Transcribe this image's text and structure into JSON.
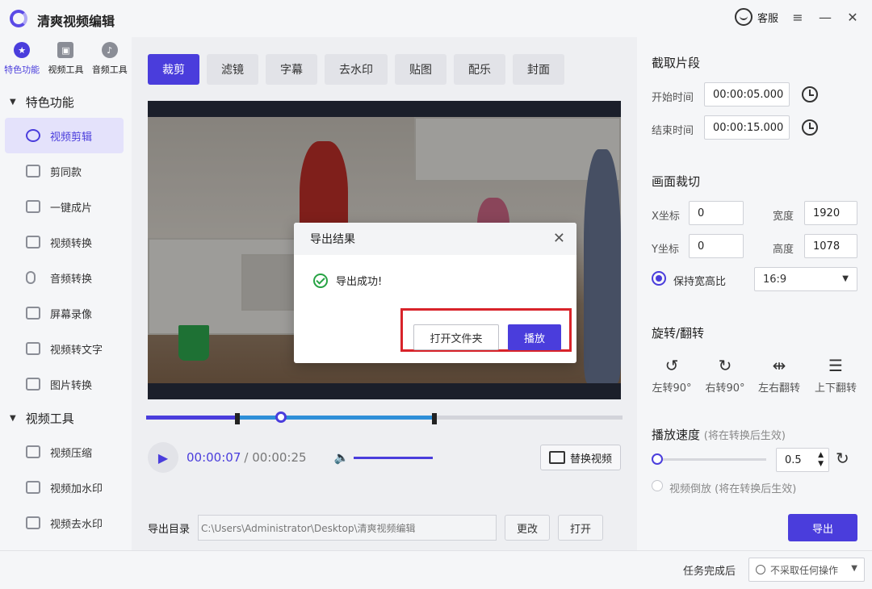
{
  "app": {
    "title": "清爽视频编辑",
    "support_label": "客服"
  },
  "window": {
    "menu_icon": "≡",
    "minimize_icon": "—",
    "close_icon": "✕"
  },
  "sidebar": {
    "top_tabs": [
      {
        "label": "特色功能",
        "icon": "star-icon"
      },
      {
        "label": "视频工具",
        "icon": "film-icon"
      },
      {
        "label": "音频工具",
        "icon": "music-icon"
      }
    ],
    "groups": [
      {
        "title": "特色功能",
        "items": [
          "视频剪辑",
          "剪同款",
          "一键成片",
          "视频转换",
          "音频转换",
          "屏幕录像",
          "视频转文字",
          "图片转换"
        ]
      },
      {
        "title": "视频工具",
        "items": [
          "视频压缩",
          "视频加水印",
          "视频去水印"
        ]
      }
    ]
  },
  "tool_tabs": [
    "裁剪",
    "滤镜",
    "字幕",
    "去水印",
    "贴图",
    "配乐",
    "封面"
  ],
  "player": {
    "current_time": "00:00:07",
    "total_time": "/ 00:00:25",
    "replace_label": "替换视频",
    "progress": 0.28
  },
  "export_dir": {
    "label": "导出目录",
    "path": "C:\\Users\\Administrator\\Desktop\\清爽视频编辑",
    "change_label": "更改",
    "open_label": "打开"
  },
  "right": {
    "clip": {
      "title": "截取片段",
      "start_label": "开始时间",
      "start_value": "00:00:05.000",
      "end_label": "结束时间",
      "end_value": "00:00:15.000"
    },
    "crop": {
      "title": "画面裁切",
      "x_label": "X坐标",
      "x_value": "0",
      "y_label": "Y坐标",
      "y_value": "0",
      "width_label": "宽度",
      "width_value": "1920",
      "height_label": "高度",
      "height_value": "1078",
      "keep_ratio_label": "保持宽高比",
      "ratio_value": "16:9"
    },
    "rotate": {
      "title": "旋转/翻转",
      "items": [
        {
          "label": "左转90°",
          "icon": "rotate-left-icon"
        },
        {
          "label": "右转90°",
          "icon": "rotate-right-icon"
        },
        {
          "label": "左右翻转",
          "icon": "flip-horizontal-icon"
        },
        {
          "label": "上下翻转",
          "icon": "flip-vertical-icon"
        }
      ]
    },
    "speed": {
      "title": "播放速度",
      "hint": "(将在转换后生效)",
      "value": "0.5",
      "reverse_label": "视频倒放",
      "reverse_hint": "(将在转换后生效)"
    },
    "export_label": "导出"
  },
  "bottom": {
    "after_label": "任务完成后",
    "after_value": "不采取任何操作"
  },
  "dialog": {
    "title": "导出结果",
    "message": "导出成功!",
    "open_folder_label": "打开文件夹",
    "play_label": "播放"
  },
  "colors": {
    "accent": "#4a3ddc",
    "success": "#27a344",
    "highlight": "#d8232a"
  }
}
